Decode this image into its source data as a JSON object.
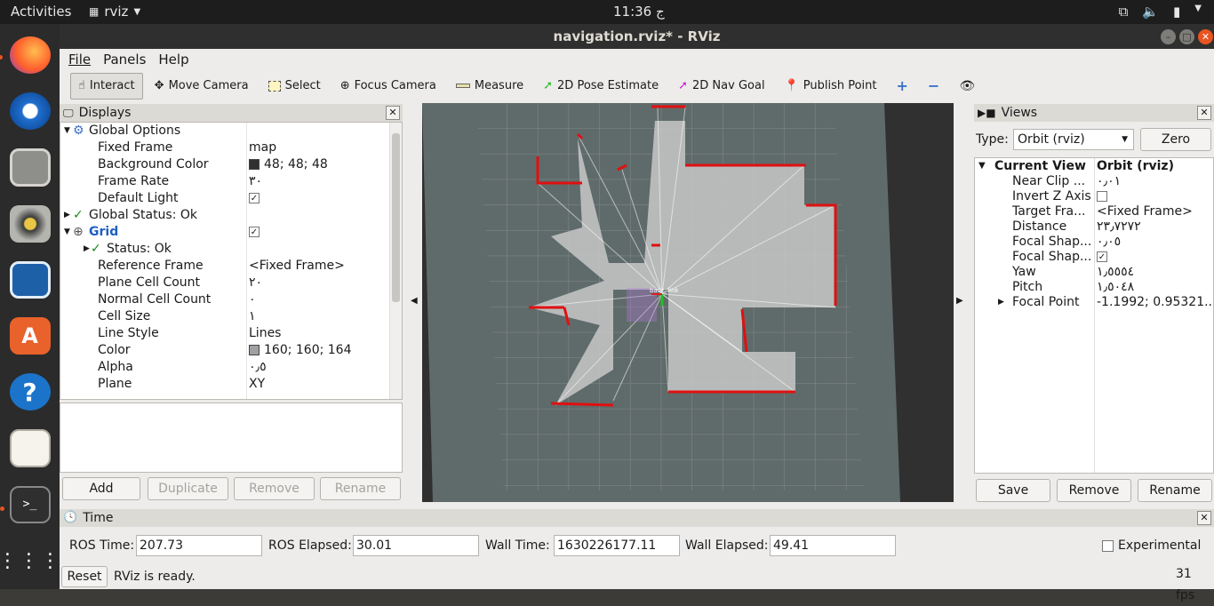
{
  "topbar": {
    "activities": "Activities",
    "app": "rviz",
    "clock": "11:36 ج"
  },
  "window": {
    "title": "navigation.rviz* - RViz"
  },
  "menu": [
    "File",
    "Panels",
    "Help"
  ],
  "toolbar": [
    "Interact",
    "Move Camera",
    "Select",
    "Focus Camera",
    "Measure",
    "2D Pose Estimate",
    "2D Nav Goal",
    "Publish Point"
  ],
  "displays": {
    "title": "Displays",
    "rows": [
      {
        "k": "Global Options",
        "v": ""
      },
      {
        "k": "Fixed Frame",
        "v": "map"
      },
      {
        "k": "Background Color",
        "v": "48; 48; 48"
      },
      {
        "k": "Frame Rate",
        "v": "٣٠"
      },
      {
        "k": "Default Light",
        "v": ""
      },
      {
        "k": "Global Status: Ok",
        "v": ""
      },
      {
        "k": "Grid",
        "v": ""
      },
      {
        "k": "Status: Ok",
        "v": ""
      },
      {
        "k": "Reference Frame",
        "v": "<Fixed Frame>"
      },
      {
        "k": "Plane Cell Count",
        "v": "٢٠"
      },
      {
        "k": "Normal Cell Count",
        "v": "٠"
      },
      {
        "k": "Cell Size",
        "v": "١"
      },
      {
        "k": "Line Style",
        "v": "Lines"
      },
      {
        "k": "Color",
        "v": "160; 160; 164"
      },
      {
        "k": "Alpha",
        "v": "٠٫٥"
      },
      {
        "k": "Plane",
        "v": "XY"
      }
    ],
    "buttons": [
      "Add",
      "Duplicate",
      "Remove",
      "Rename"
    ]
  },
  "views": {
    "title": "Views",
    "type_label": "Type:",
    "type_value": "Orbit (rviz)",
    "zero": "Zero",
    "head_k": "Current View",
    "head_v": "Orbit (rviz)",
    "rows": [
      {
        "k": "Near Clip ...",
        "v": "٠٫٠١"
      },
      {
        "k": "Invert Z Axis",
        "v": ""
      },
      {
        "k": "Target Fra...",
        "v": "<Fixed Frame>"
      },
      {
        "k": "Distance",
        "v": "٢٣٫٧٢٧٢"
      },
      {
        "k": "Focal Shap...",
        "v": "٠٫٠٥"
      },
      {
        "k": "Focal Shap...",
        "v": ""
      },
      {
        "k": "Yaw",
        "v": "١٫٥٥٥٤"
      },
      {
        "k": "Pitch",
        "v": "١٫٥٠٤٨"
      },
      {
        "k": "Focal Point",
        "v": "-1.1992; 0.95321..."
      }
    ],
    "buttons": [
      "Save",
      "Remove",
      "Rename"
    ]
  },
  "time": {
    "title": "Time",
    "ros_time_label": "ROS Time:",
    "ros_time": "207.73",
    "ros_elapsed_label": "ROS Elapsed:",
    "ros_elapsed": "30.01",
    "wall_time_label": "Wall Time:",
    "wall_time": "1630226177.11",
    "wall_elapsed_label": "Wall Elapsed:",
    "wall_elapsed": "49.41",
    "experimental": "Experimental"
  },
  "status": {
    "reset": "Reset",
    "message": "RViz is ready.",
    "fps": "31 fps"
  },
  "viewport": {
    "frame_label": "base_link"
  }
}
